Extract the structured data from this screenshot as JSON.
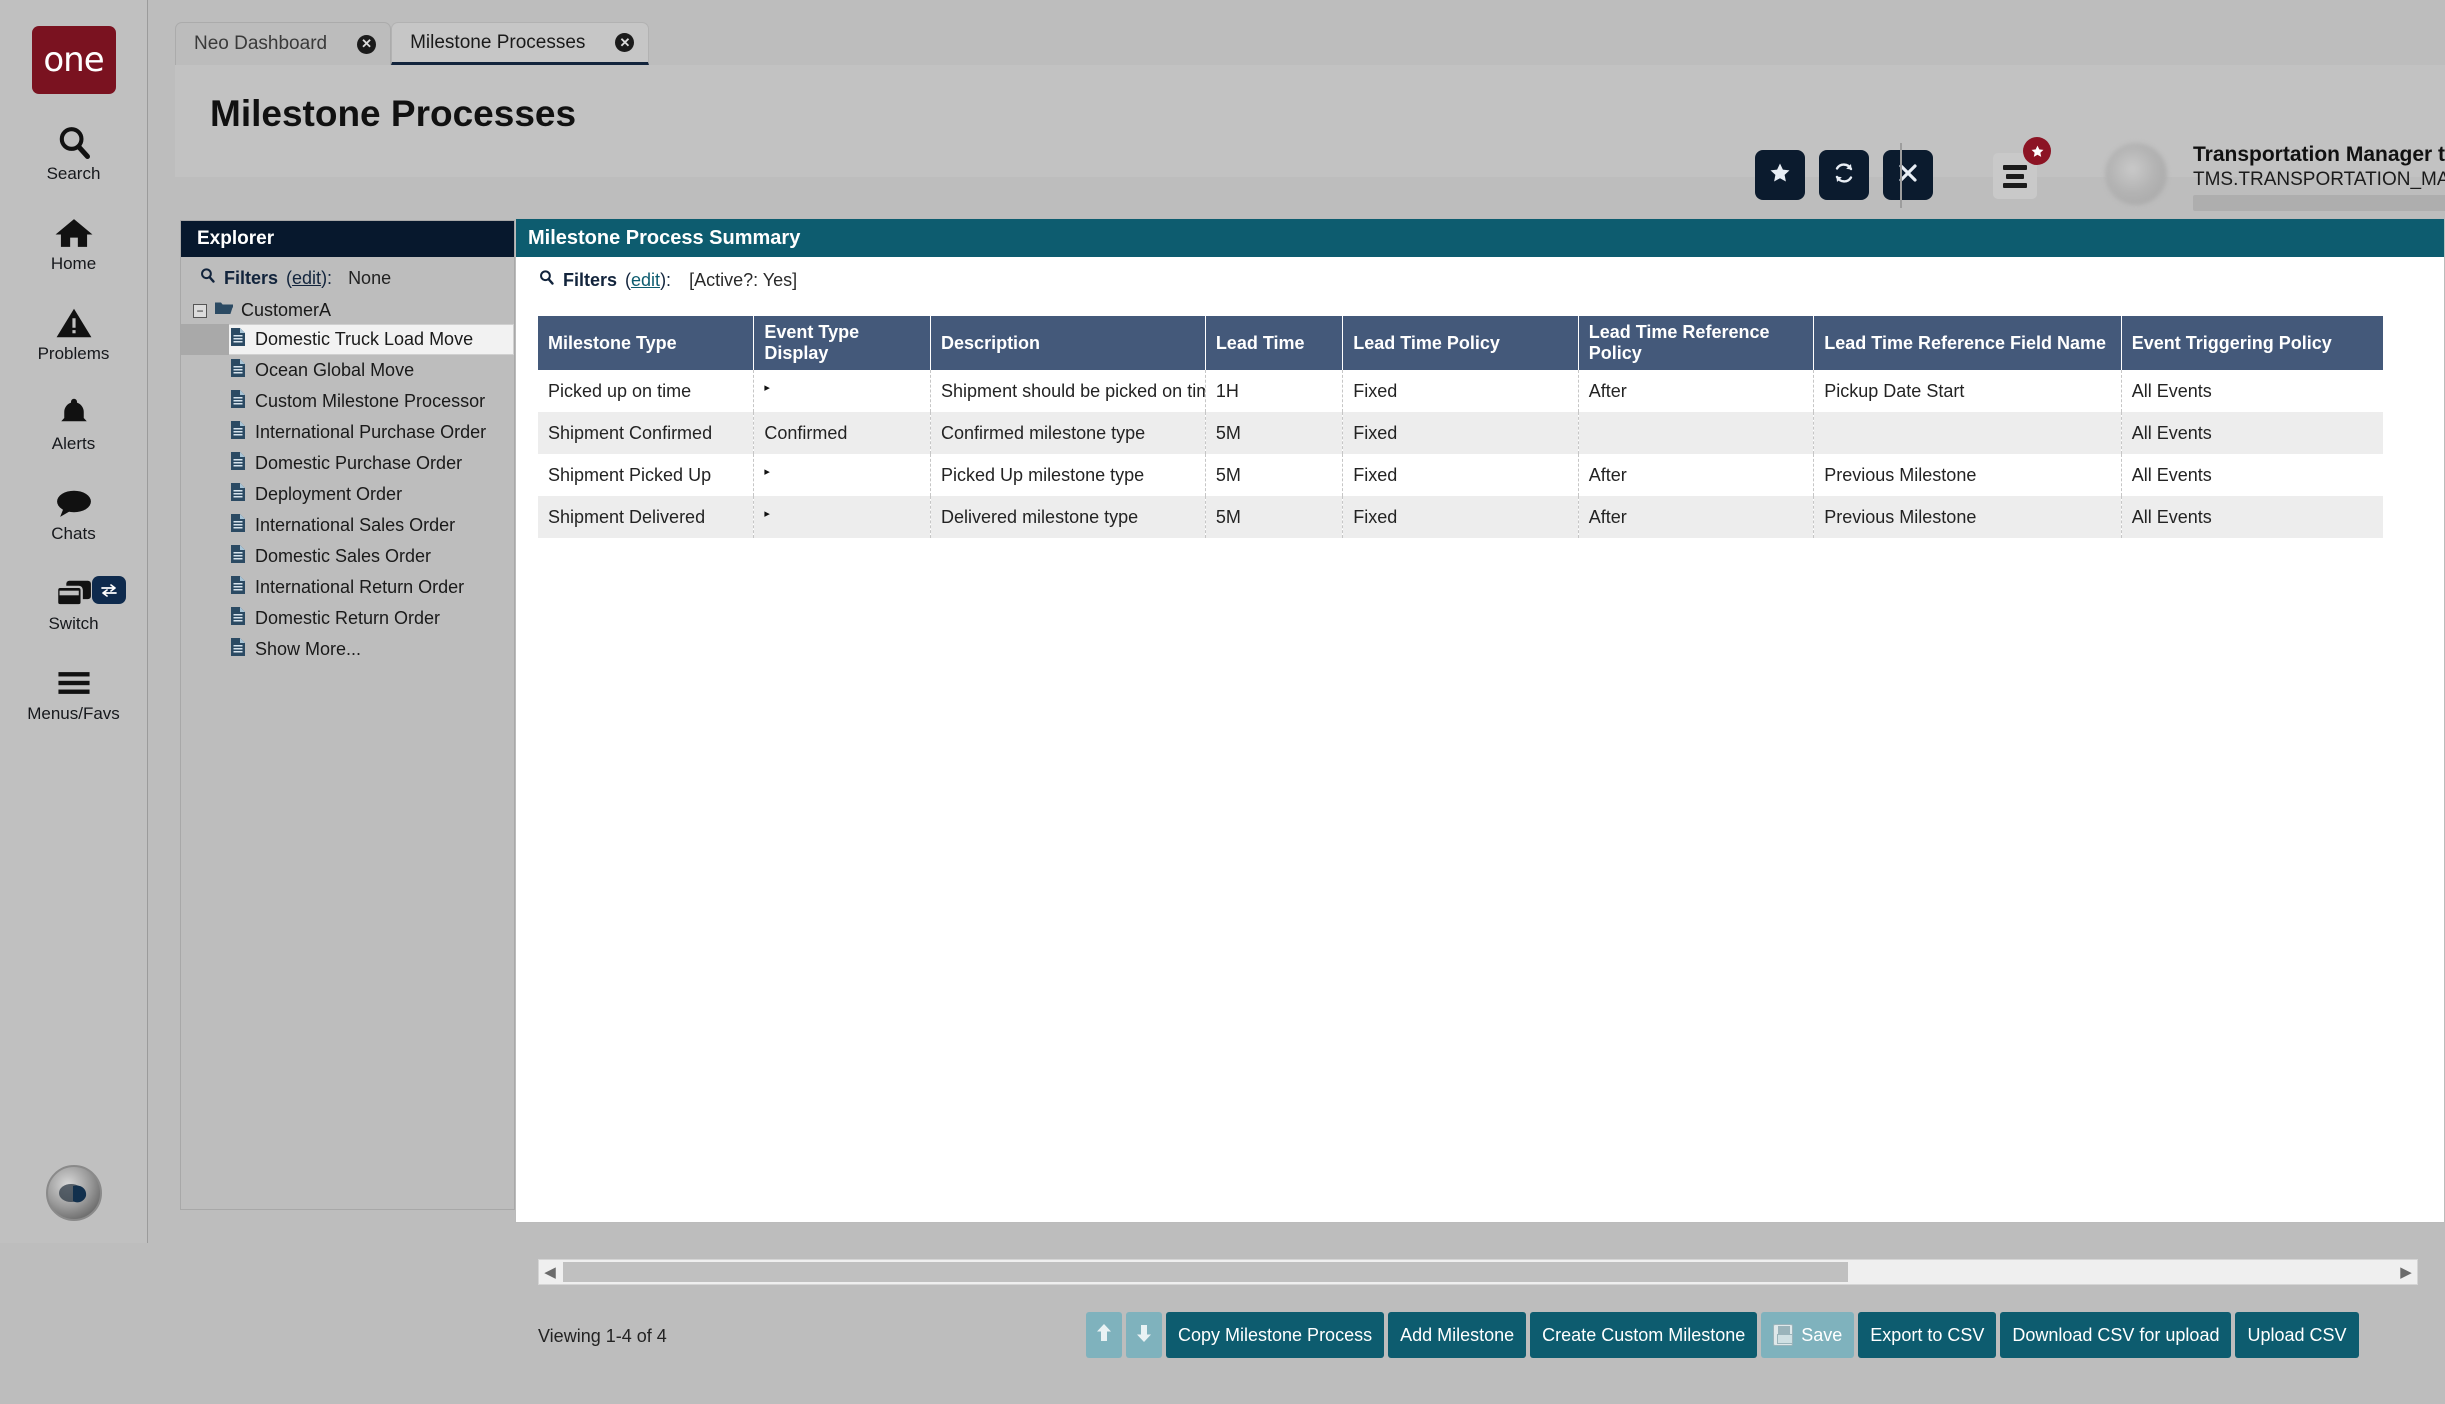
{
  "rail": {
    "logo_text": "one",
    "items": [
      {
        "label": "Search",
        "icon": "search-icon"
      },
      {
        "label": "Home",
        "icon": "home-icon"
      },
      {
        "label": "Problems",
        "icon": "warning-triangle-icon"
      },
      {
        "label": "Alerts",
        "icon": "bell-icon"
      },
      {
        "label": "Chats",
        "icon": "chat-bubble-icon"
      },
      {
        "label": "Switch",
        "icon": "windows-stack-icon",
        "badge_icon": "swap-arrows-icon"
      },
      {
        "label": "Menus/Favs",
        "icon": "hamburger-icon"
      }
    ]
  },
  "tabs": [
    {
      "label": "Neo Dashboard",
      "active": false,
      "close_icon": "close-icon"
    },
    {
      "label": "Milestone Processes",
      "active": true,
      "close_icon": "close-icon"
    }
  ],
  "header": {
    "title": "Milestone Processes",
    "actions": [
      {
        "name": "favorite-button",
        "icon": "star-icon"
      },
      {
        "name": "refresh-button",
        "icon": "refresh-icon"
      },
      {
        "name": "close-button",
        "icon": "x-icon"
      }
    ],
    "menu_icon": "hamburger-menu-icon",
    "menu_badge_icon": "star-icon",
    "user_name": "Transportation Manager test",
    "user_role": "TMS.TRANSPORTATION_MANAGER",
    "caret_icon": "chevron-down-icon"
  },
  "explorer": {
    "title": "Explorer",
    "filters_label": "Filters",
    "filters_edit": "edit",
    "filters_value": "None",
    "search_icon": "search-icon",
    "root": {
      "label": "CustomerA",
      "expanded": true,
      "toggle_glyph": "−",
      "folder_icon": "folder-open-icon"
    },
    "items": [
      {
        "label": "Domestic Truck Load Move",
        "selected": true
      },
      {
        "label": "Ocean Global Move",
        "selected": false
      },
      {
        "label": "Custom Milestone Processor",
        "selected": false
      },
      {
        "label": "International Purchase Order",
        "selected": false
      },
      {
        "label": "Domestic Purchase Order",
        "selected": false
      },
      {
        "label": "Deployment Order",
        "selected": false
      },
      {
        "label": "International Sales Order",
        "selected": false
      },
      {
        "label": "Domestic Sales Order",
        "selected": false
      },
      {
        "label": "International Return Order",
        "selected": false
      },
      {
        "label": "Domestic Return Order",
        "selected": false
      },
      {
        "label": "Show More...",
        "selected": false
      }
    ]
  },
  "panel": {
    "title": "Milestone Process Summary",
    "filters_label": "Filters",
    "filters_edit": "edit",
    "filters_value": "[Active?: Yes]",
    "search_icon": "search-icon"
  },
  "table": {
    "columns": [
      "Milestone Type",
      "Event Type Display",
      "Description",
      "Lead Time",
      "Lead Time Policy",
      "Lead Time Reference Policy",
      "Lead Time Reference Field Name",
      "Event Triggering Policy"
    ],
    "rows": [
      {
        "milestone_type": "Picked up on time",
        "event_type_display": "",
        "event_type_marker": "▸",
        "description": "Shipment should be picked on time",
        "lead_time": "1H",
        "lead_time_policy": "Fixed",
        "lead_time_reference_policy": "After",
        "lead_time_reference_field_name": "Pickup Date Start",
        "event_triggering_policy": "All Events"
      },
      {
        "milestone_type": "Shipment Confirmed",
        "event_type_display": "Confirmed",
        "event_type_marker": "",
        "description": "Confirmed milestone type",
        "lead_time": "5M",
        "lead_time_policy": "Fixed",
        "lead_time_reference_policy": "",
        "lead_time_reference_field_name": "",
        "event_triggering_policy": "All Events"
      },
      {
        "milestone_type": "Shipment Picked Up",
        "event_type_display": "",
        "event_type_marker": "▸",
        "description": "Picked Up milestone type",
        "lead_time": "5M",
        "lead_time_policy": "Fixed",
        "lead_time_reference_policy": "After",
        "lead_time_reference_field_name": "Previous Milestone",
        "event_triggering_policy": "All Events"
      },
      {
        "milestone_type": "Shipment Delivered",
        "event_type_display": "",
        "event_type_marker": "▸",
        "description": "Delivered milestone type",
        "lead_time": "5M",
        "lead_time_policy": "Fixed",
        "lead_time_reference_policy": "After",
        "lead_time_reference_field_name": "Previous Milestone",
        "event_triggering_policy": "All Events"
      }
    ]
  },
  "scrollbar": {
    "left_arrow": "◀",
    "right_arrow": "▶"
  },
  "footer": {
    "viewing": "Viewing 1-4 of 4",
    "move_up_icon": "arrow-up-icon",
    "move_down_icon": "arrow-down-icon",
    "buttons": [
      {
        "label": "Copy Milestone Process",
        "disabled": false
      },
      {
        "label": "Add Milestone",
        "disabled": false
      },
      {
        "label": "Create Custom Milestone",
        "disabled": false
      },
      {
        "label": "Save",
        "disabled": true,
        "icon": "floppy-disk-icon"
      },
      {
        "label": "Export to CSV",
        "disabled": false
      },
      {
        "label": "Download CSV for upload",
        "disabled": false
      },
      {
        "label": "Upload CSV",
        "disabled": false
      }
    ]
  },
  "colors": {
    "brand_red": "#7a1220",
    "navy": "#07182d",
    "teal": "#0d5c6f",
    "teal_disabled": "#7fb2bd",
    "table_header": "#44597a",
    "link": "#2a5f8f"
  }
}
